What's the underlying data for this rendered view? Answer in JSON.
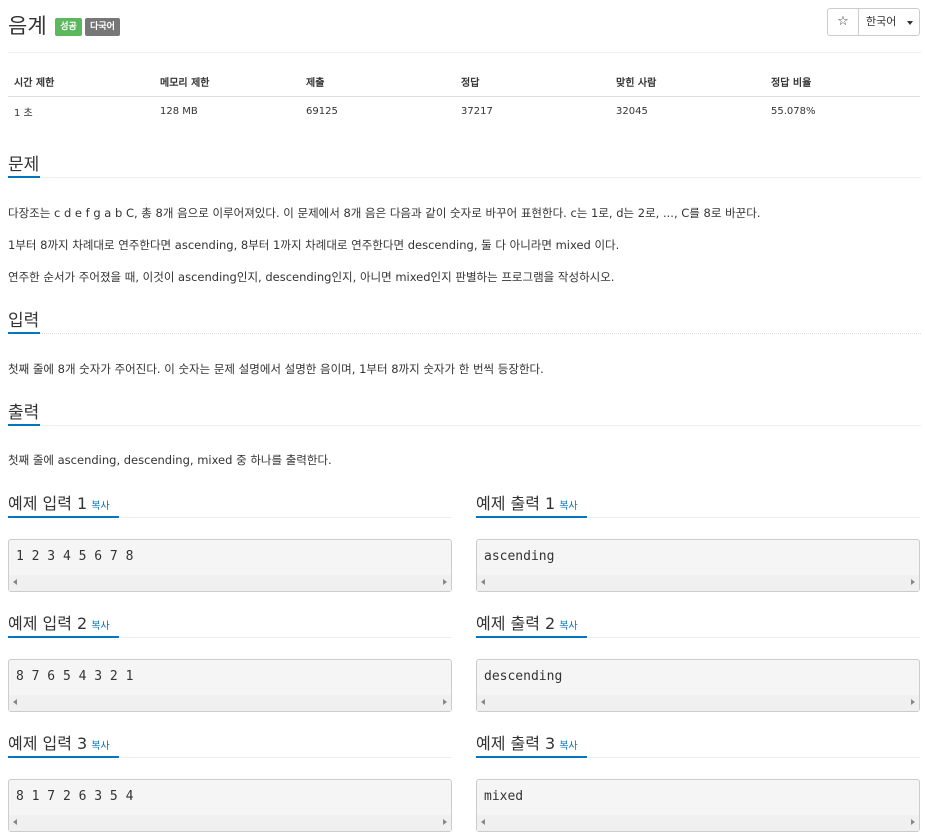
{
  "problem": {
    "title": "음계",
    "badges": [
      "성공",
      "다국어"
    ],
    "star": "☆",
    "language": "한국어"
  },
  "info_table": {
    "headers": [
      "시간 제한",
      "메모리 제한",
      "제출",
      "정답",
      "맞힌 사람",
      "정답 비율"
    ],
    "values": [
      "1 초",
      "128 MB",
      "69125",
      "37217",
      "32045",
      "55.078%"
    ]
  },
  "sections": {
    "description": {
      "title": "문제",
      "paragraphs": [
        "다장조는 c d e f g a b C, 총 8개 음으로 이루어져있다. 이 문제에서 8개 음은 다음과 같이 숫자로 바꾸어 표현한다. c는 1로, d는 2로, ..., C를 8로 바꾼다.",
        "1부터 8까지 차례대로 연주한다면 ascending, 8부터 1까지 차례대로 연주한다면 descending, 둘 다 아니라면 mixed 이다.",
        "연주한 순서가 주어졌을 때, 이것이 ascending인지, descending인지, 아니면 mixed인지 판별하는 프로그램을 작성하시오."
      ]
    },
    "input": {
      "title": "입력",
      "text": "첫째 줄에 8개 숫자가 주어진다. 이 숫자는 문제 설명에서 설명한 음이며, 1부터 8까지 숫자가 한 번씩 등장한다."
    },
    "output": {
      "title": "출력",
      "text": "첫째 줄에 ascending, descending, mixed 중 하나를 출력한다."
    }
  },
  "examples": [
    {
      "input_title": "예제 입력 1",
      "output_title": "예제 출력 1",
      "copy": "복사",
      "input": "1 2 3 4 5 6 7 8",
      "output": "ascending"
    },
    {
      "input_title": "예제 입력 2",
      "output_title": "예제 출력 2",
      "copy": "복사",
      "input": "8 7 6 5 4 3 2 1",
      "output": "descending"
    },
    {
      "input_title": "예제 입력 3",
      "output_title": "예제 출력 3",
      "copy": "복사",
      "input": "8 1 7 2 6 3 5 4",
      "output": "mixed"
    }
  ]
}
